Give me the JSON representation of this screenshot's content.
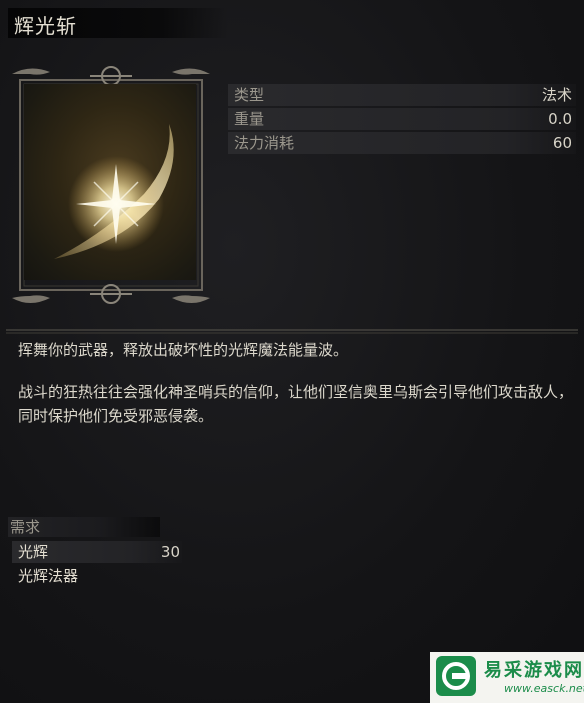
{
  "item": {
    "name": "辉光斩"
  },
  "stats": [
    {
      "label": "类型",
      "value": "法术"
    },
    {
      "label": "重量",
      "value": "0.0"
    },
    {
      "label": "法力消耗",
      "value": "60"
    }
  ],
  "description": {
    "line1": "挥舞你的武器，释放出破坏性的光辉魔法能量波。",
    "line2": "战斗的狂热往往会强化神圣哨兵的信仰，让他们坚信奥里乌斯会引导他们攻击敌人，同时保护他们免受邪恶侵袭。"
  },
  "requirements": {
    "header": "需求",
    "items": [
      {
        "label": "光辉",
        "value": "30"
      },
      {
        "label": "光辉法器",
        "value": ""
      }
    ]
  },
  "watermark": {
    "name": "易采游戏网",
    "url": "www.easck.net"
  },
  "colors": {
    "background": "#151517",
    "text": "#d8d4c8",
    "muted": "#9b978d",
    "glow": "#f2dfa0"
  }
}
